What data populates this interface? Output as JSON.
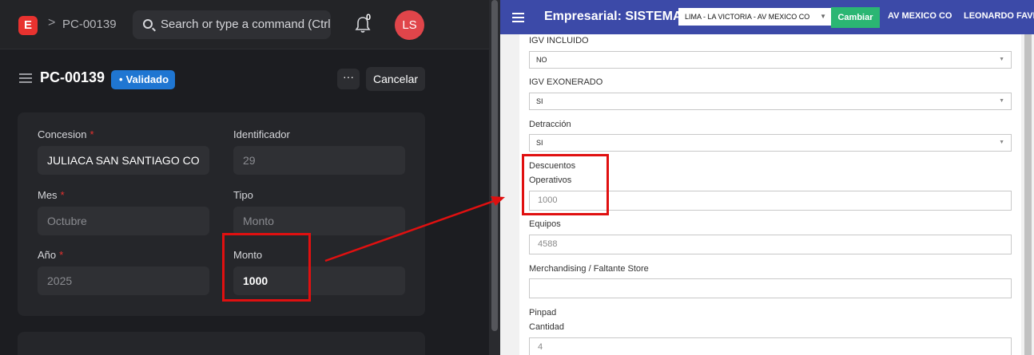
{
  "left": {
    "breadcrumb": {
      "logo_letter": "E",
      "separator": ">",
      "doc_id": "PC-00139"
    },
    "search": {
      "placeholder": "Search or type a command (Ctrl"
    },
    "notifications": {
      "count": "0"
    },
    "user": {
      "initials": "LS"
    },
    "header": {
      "title": "PC-00139",
      "status": "Validado",
      "more_label": "···",
      "cancel_label": "Cancelar"
    },
    "form": {
      "concesion_label": "Concesion",
      "concesion_value": "JULIACA SAN SANTIAGO CO",
      "identificador_label": "Identificador",
      "identificador_value": "29",
      "mes_label": "Mes",
      "mes_value": "Octubre",
      "tipo_label": "Tipo",
      "tipo_value": "Monto",
      "anio_label": "Año",
      "anio_value": "2025",
      "monto_label": "Monto",
      "monto_value": "1000",
      "required_mark": "*"
    }
  },
  "right": {
    "navbar": {
      "brand": "Empresarial: SISTEMAS",
      "sede_selected": "LIMA - LA VICTORIA - AV MEXICO CO",
      "cambiar_label": "Cambiar",
      "location": "AV MEXICO CO",
      "user_name": "LEONARDO FAVIO"
    },
    "form": {
      "igv_incluido_label": "IGV INCLUIDO",
      "igv_incluido_value": "NO",
      "igv_exonerado_label": "IGV EXONERADO",
      "igv_exonerado_value": "SI",
      "detraccion_label": "Detracción",
      "detraccion_value": "SI",
      "descuentos_label": "Descuentos",
      "operativos_label": "Operativos",
      "operativos_value": "1000",
      "equipos_label": "Equipos",
      "equipos_value": "4588",
      "merch_label": "Merchandising / Faltante Store",
      "merch_value": "",
      "pinpad_label": "Pinpad",
      "cantidad_label": "Cantidad",
      "cantidad_value": "4"
    }
  },
  "colors": {
    "accent_red": "#e01010",
    "navbar_blue": "#3c4aa8",
    "badge_blue": "#1f76d2",
    "button_green": "#2bb673"
  }
}
